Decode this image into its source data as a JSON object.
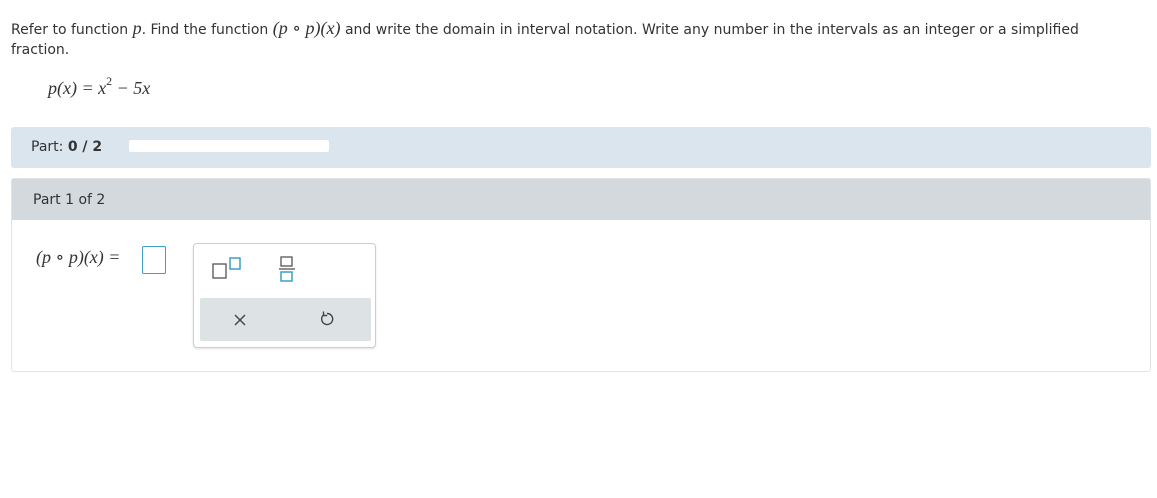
{
  "question": {
    "intro": "Refer to function",
    "after_p": ". Find the function",
    "rest": "and write the domain in interval notation. Write any number in the intervals as an integer or a simplified fraction.",
    "var_p": "p",
    "composite": "(p ∘ p)(x)"
  },
  "given_function": {
    "lhs": "p(x) = x",
    "exponent": "2",
    "rhs": " − 5x"
  },
  "progress": {
    "label": "Part:",
    "value": "0 / 2",
    "fraction": 0
  },
  "part": {
    "header": "Part 1 of 2",
    "answer_lhs": "(p ∘ p)(x) ="
  },
  "tools": {
    "exponent": "exponent-tool",
    "fraction": "fraction-tool",
    "clear": "clear-icon",
    "undo": "undo-icon"
  },
  "colors": {
    "part_bar_bg": "#dae5ee",
    "part_header_bg": "#d3d9dc",
    "accent": "#3e9ec7"
  }
}
